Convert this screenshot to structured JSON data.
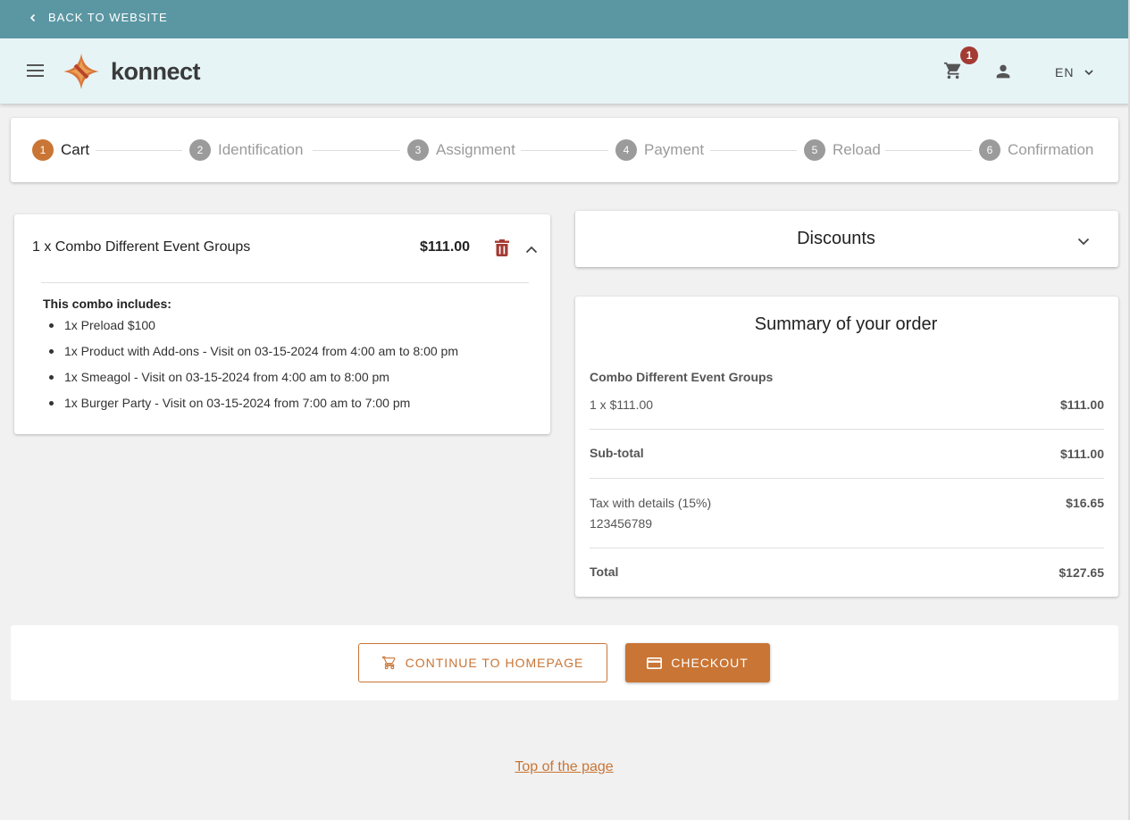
{
  "topbar": {
    "back_label": "BACK TO WEBSITE"
  },
  "header": {
    "brand": "konnect",
    "cart_count": "1",
    "language": "EN"
  },
  "stepper": [
    {
      "num": "1",
      "label": "Cart"
    },
    {
      "num": "2",
      "label": "Identification"
    },
    {
      "num": "3",
      "label": "Assignment"
    },
    {
      "num": "4",
      "label": "Payment"
    },
    {
      "num": "5",
      "label": "Reload"
    },
    {
      "num": "6",
      "label": "Confirmation"
    }
  ],
  "cart": {
    "item_title": "1 x Combo Different Event Groups",
    "item_price": "$111.00",
    "combo_label": "This combo includes:",
    "combo_items": [
      "1x Preload $100",
      "1x Product with Add-ons - Visit on 03-15-2024 from 4:00 am to 8:00 pm",
      "1x Smeagol - Visit on 03-15-2024 from 4:00 am to 8:00 pm",
      "1x Burger Party - Visit on 03-15-2024 from 7:00 am to 7:00 pm"
    ]
  },
  "discounts": {
    "title": "Discounts"
  },
  "summary": {
    "title": "Summary of your order",
    "product_name": "Combo Different Event Groups",
    "product_qty": "1 x $111.00",
    "product_total": "$111.00",
    "subtotal_label": "Sub-total",
    "subtotal_value": "$111.00",
    "tax_label": "Tax with details (15%)",
    "tax_detail": "123456789",
    "tax_value": "$16.65",
    "total_label": "Total",
    "total_value": "$127.65"
  },
  "actions": {
    "continue_label": "CONTINUE TO HOMEPAGE",
    "checkout_label": "CHECKOUT"
  },
  "footer": {
    "top_link": "Top of the page"
  },
  "colors": {
    "topbar": "#5b97a3",
    "header": "#e6f4f6",
    "accent": "#c97535",
    "badge": "#a33b33"
  }
}
